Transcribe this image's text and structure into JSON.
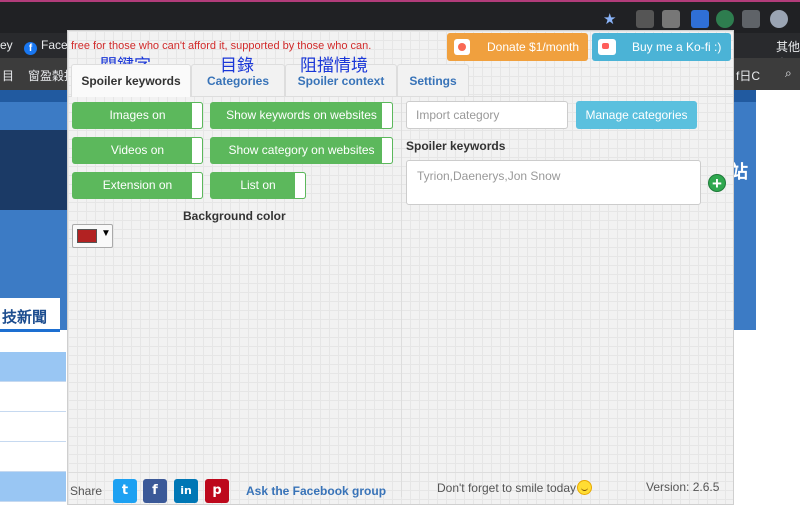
{
  "browser": {
    "bookmarks": [
      "ey",
      "Facel",
      "目",
      "窗盈穀搞",
      "其他書"
    ],
    "right_partial_text": "f日C"
  },
  "background_page": {
    "nav_tab": "技新聞",
    "banner_right_text": "站"
  },
  "popup": {
    "tagline": "free for those who can't afford it, supported by those who can.",
    "donate_label": "Donate $1/month",
    "kofi_label": "Buy me a Ko-fi :)",
    "annotations": [
      "關鍵字",
      "目錄",
      "阻擋情境"
    ],
    "tabs": [
      {
        "label": "Spoiler keywords",
        "active": true
      },
      {
        "label": "Categories",
        "active": false
      },
      {
        "label": "Spoiler context",
        "active": false
      },
      {
        "label": "Settings",
        "active": false
      }
    ],
    "toggles": {
      "images": "Images on",
      "videos": "Videos on",
      "extension": "Extension on",
      "show_keywords": "Show keywords on websites",
      "show_category": "Show category on websites",
      "list": "List on"
    },
    "background_color_label": "Background color",
    "background_color_value": "#b22222",
    "import_placeholder": "Import category",
    "manage_categories_label": "Manage categories",
    "spoiler_keywords_label": "Spoiler keywords",
    "keywords_placeholder": "Tyrion,Daenerys,Jon Snow",
    "footer": {
      "share_label": "Share",
      "facebook_group_label": "Ask the Facebook group",
      "smile_text": "Don't forget to smile today",
      "version": "Version: 2.6.5"
    }
  }
}
